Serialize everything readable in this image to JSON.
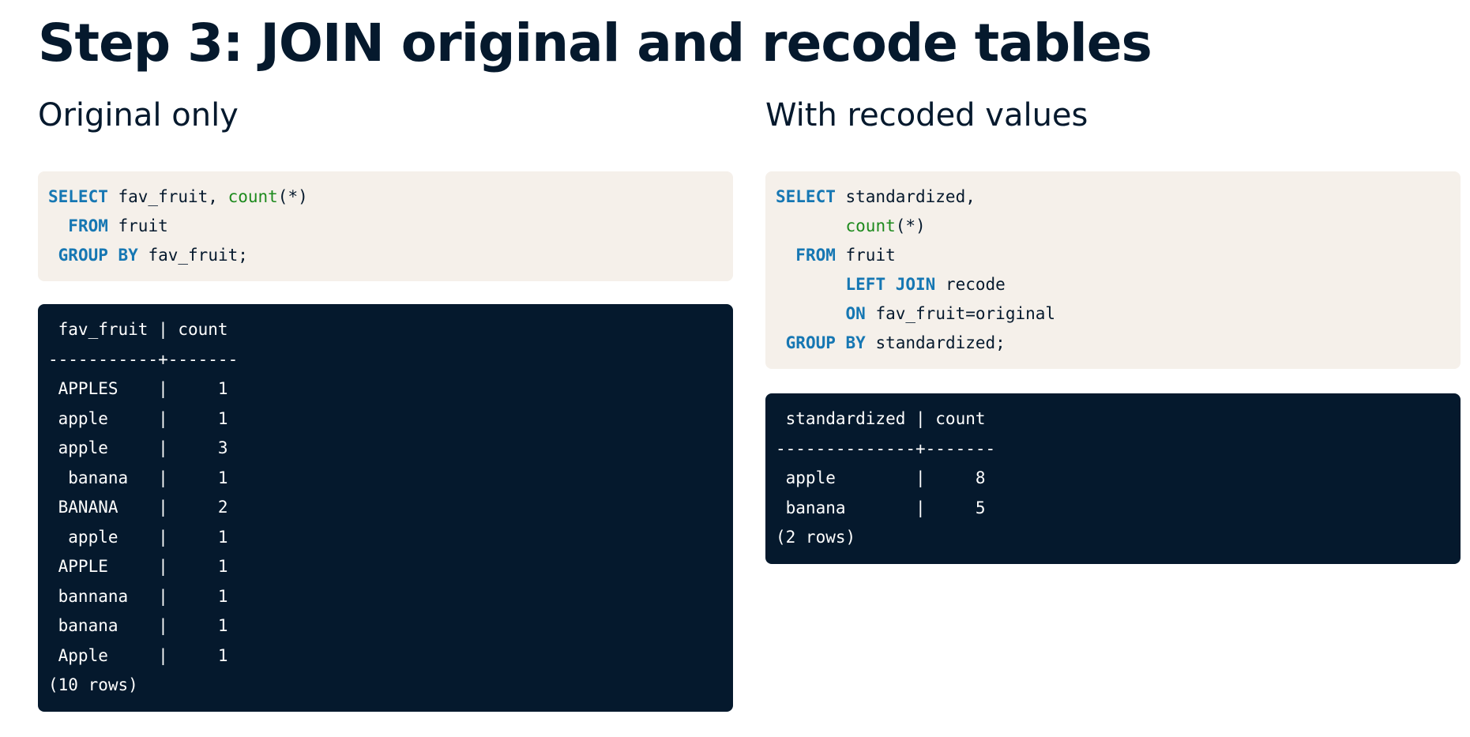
{
  "title": "Step 3: JOIN original and recode tables",
  "left": {
    "subtitle": "Original only",
    "code": [
      [
        {
          "t": "kw",
          "v": "SELECT"
        },
        {
          "t": "tx",
          "v": " fav_fruit, "
        },
        {
          "t": "fn",
          "v": "count"
        },
        {
          "t": "tx",
          "v": "(*)"
        }
      ],
      [
        {
          "t": "tx",
          "v": "  "
        },
        {
          "t": "kw",
          "v": "FROM"
        },
        {
          "t": "tx",
          "v": " fruit"
        }
      ],
      [
        {
          "t": "tx",
          "v": " "
        },
        {
          "t": "kw",
          "v": "GROUP BY"
        },
        {
          "t": "tx",
          "v": " fav_fruit;"
        }
      ]
    ],
    "output": [
      " fav_fruit | count",
      "-----------+-------",
      " APPLES    |     1",
      " apple     |     1",
      " apple     |     3",
      "  banana   |     1",
      " BANANA    |     2",
      "  apple    |     1",
      " APPLE     |     1",
      " bannana   |     1",
      " banana    |     1",
      " Apple     |     1",
      "(10 rows)"
    ]
  },
  "right": {
    "subtitle": "With recoded values",
    "code": [
      [
        {
          "t": "kw",
          "v": "SELECT"
        },
        {
          "t": "tx",
          "v": " standardized,"
        }
      ],
      [
        {
          "t": "tx",
          "v": "       "
        },
        {
          "t": "fn",
          "v": "count"
        },
        {
          "t": "tx",
          "v": "(*)"
        }
      ],
      [
        {
          "t": "tx",
          "v": "  "
        },
        {
          "t": "kw",
          "v": "FROM"
        },
        {
          "t": "tx",
          "v": " fruit"
        }
      ],
      [
        {
          "t": "tx",
          "v": "       "
        },
        {
          "t": "kw",
          "v": "LEFT JOIN"
        },
        {
          "t": "tx",
          "v": " recode"
        }
      ],
      [
        {
          "t": "tx",
          "v": "       "
        },
        {
          "t": "kw",
          "v": "ON"
        },
        {
          "t": "tx",
          "v": " fav_fruit=original"
        }
      ],
      [
        {
          "t": "tx",
          "v": " "
        },
        {
          "t": "kw",
          "v": "GROUP BY"
        },
        {
          "t": "tx",
          "v": " standardized;"
        }
      ]
    ],
    "output": [
      " standardized | count",
      "--------------+-------",
      " apple        |     8",
      " banana       |     5",
      "(2 rows)"
    ]
  },
  "colors": {
    "heading": "#05192d",
    "code_bg": "#f5f0ea",
    "output_bg": "#05192d",
    "keyword": "#1677b3",
    "function": "#1d8a1d"
  }
}
